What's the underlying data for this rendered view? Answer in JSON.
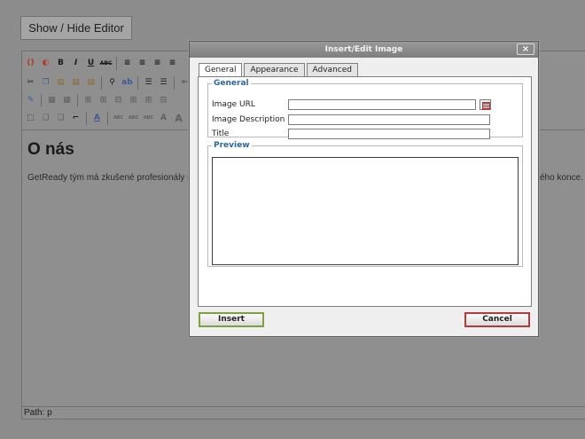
{
  "page": {
    "show_hide_label": "Show / Hide Editor"
  },
  "editor": {
    "content_title": "O nás",
    "content_text": "GetReady tým má zkušené profesionály s",
    "content_text_tail": "ého konce. P",
    "path_label": "Path: p"
  },
  "dialog": {
    "title": "Insert/Edit Image",
    "close_glyph": "×",
    "tabs": [
      {
        "label": "General",
        "active": true
      },
      {
        "label": "Appearance",
        "active": false
      },
      {
        "label": "Advanced",
        "active": false
      }
    ],
    "general_legend": "General",
    "fields": {
      "image_url_label": "Image URL",
      "image_url_value": "",
      "image_description_label": "Image Description",
      "image_description_value": "",
      "title_label": "Title",
      "title_value": ""
    },
    "preview_legend": "Preview",
    "insert_label": "Insert",
    "cancel_label": "Cancel"
  },
  "icons": {
    "browse": "browse-icon"
  },
  "colors": {
    "legend_blue": "#2b66a8",
    "insert_border": "#7ca33c",
    "cancel_border": "#b23b3b",
    "overlay_gray": "#8c8c8c"
  }
}
